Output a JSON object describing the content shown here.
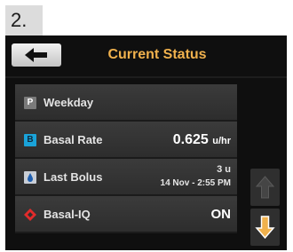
{
  "step_number": "2.",
  "header": {
    "back_icon": "left-arrow-icon",
    "title": "Current Status"
  },
  "rows": [
    {
      "icon": "profile-p-icon",
      "icon_text": "P",
      "label": "Weekday"
    },
    {
      "icon": "basal-b-icon",
      "icon_text": "B",
      "label": "Basal Rate",
      "value": "0.625",
      "unit": "u/hr"
    },
    {
      "icon": "drop-icon",
      "label": "Last Bolus",
      "amount": "3 u",
      "time": "14 Nov - 2:55 PM"
    },
    {
      "icon": "basal-iq-diamond-icon",
      "label": "Basal-IQ",
      "value": "ON"
    }
  ],
  "scroll": {
    "up_icon": "up-arrow-icon",
    "down_icon": "down-arrow-icon"
  },
  "colors": {
    "title": "#f0b14d",
    "down_arrow": "#f0b14d",
    "basal_badge": "#1aa3d9",
    "basal_iq_diamond": "#e22b2b"
  }
}
